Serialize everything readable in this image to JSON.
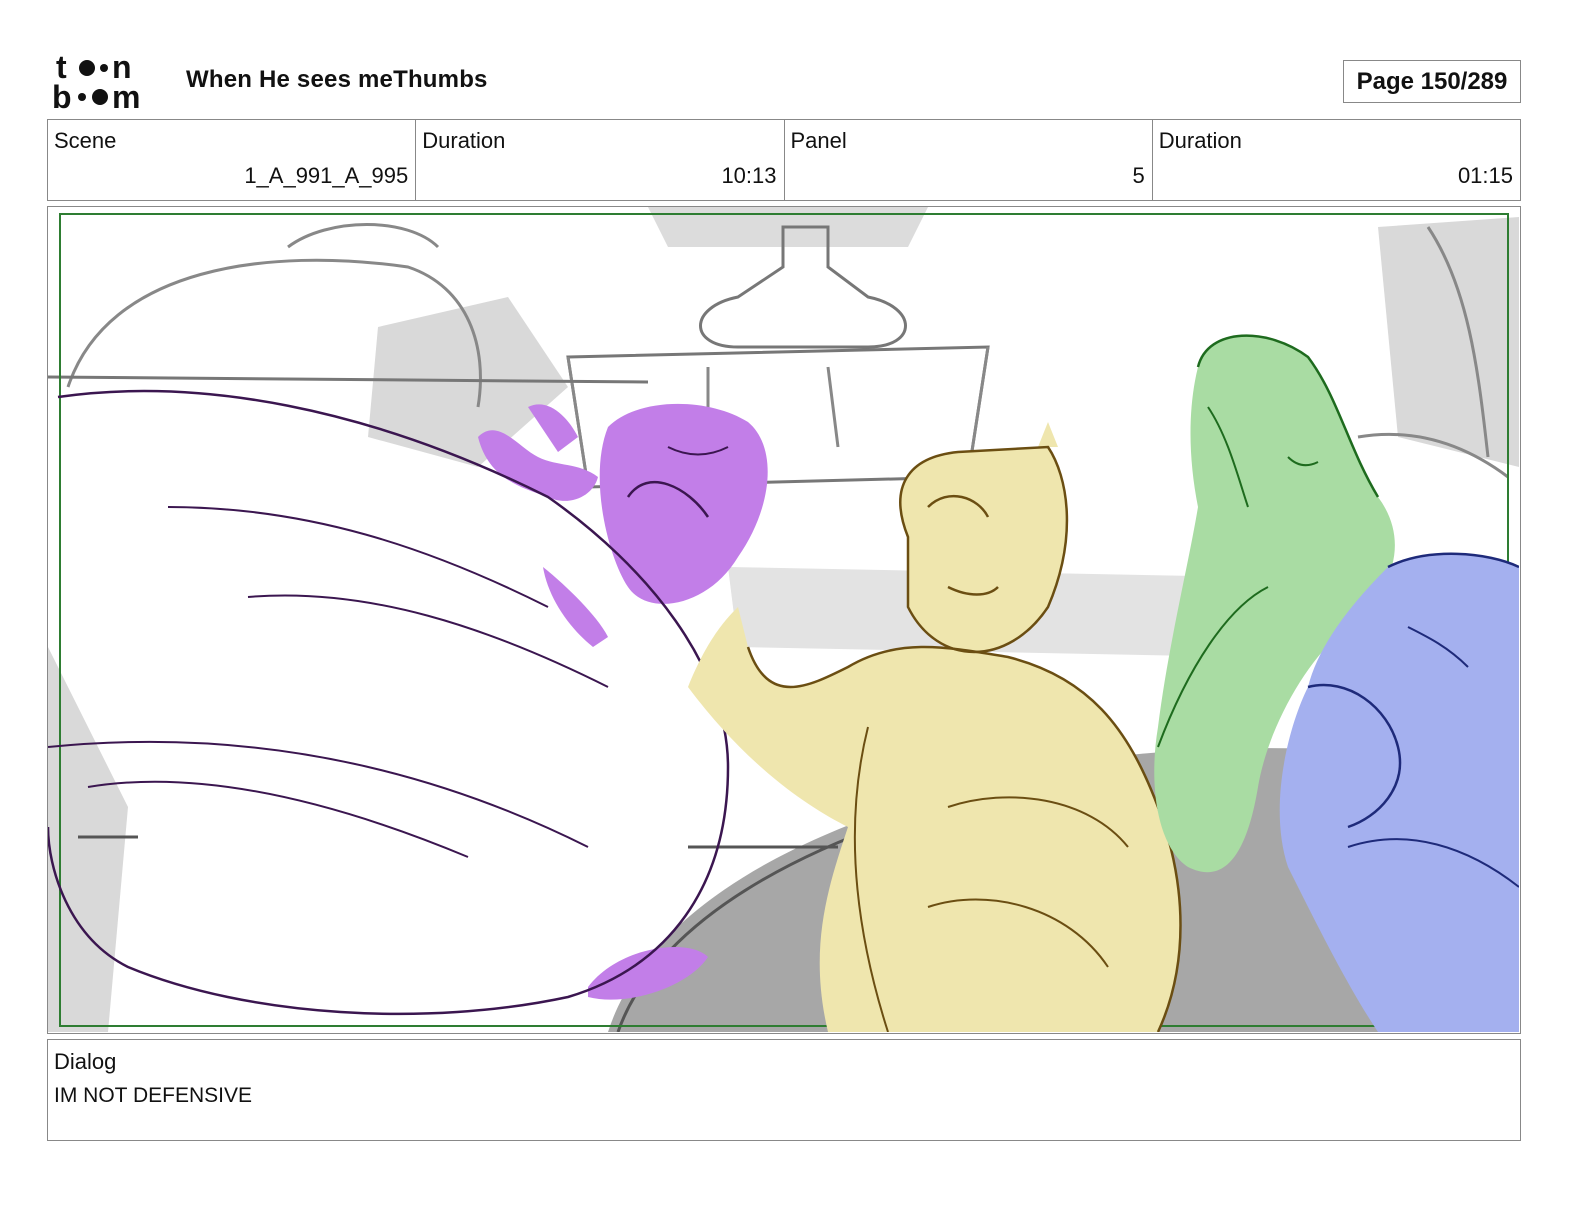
{
  "header": {
    "logo_text": "toon boom",
    "project_title": "When He sees meThumbs",
    "page_label": "Page 150/289"
  },
  "info": [
    {
      "label": "Scene",
      "value": "1_A_991_A_995"
    },
    {
      "label": "Duration",
      "value": "10:13"
    },
    {
      "label": "Panel",
      "value": "5"
    },
    {
      "label": "Duration",
      "value": "01:15"
    }
  ],
  "panel": {
    "colors": {
      "background_sketch": "#8a8a8a",
      "background_fill": "#d9d9d9",
      "floor": "#a7a7a7",
      "safe_frame": "#2e7d32",
      "purple_character": "#c27ee8",
      "purple_line": "#3b1650",
      "yellow_character": "#efe6ae",
      "yellow_line": "#6b4e12",
      "green_character": "#a9dca3",
      "green_line": "#1e6b1e",
      "blue_character": "#a4b0ef",
      "blue_line": "#1e2a7a"
    }
  },
  "dialog": {
    "label": "Dialog",
    "text": "IM NOT DEFENSIVE"
  }
}
